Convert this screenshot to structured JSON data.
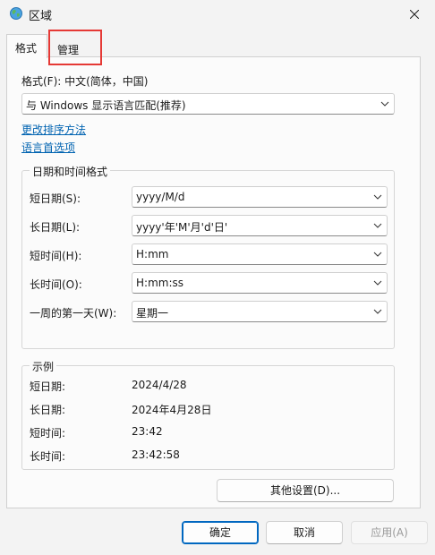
{
  "window": {
    "title": "区域"
  },
  "tabs": [
    {
      "label": "格式"
    },
    {
      "label": "管理"
    }
  ],
  "format": {
    "label": "格式(F): 中文(简体，中国)",
    "dropdown_value": "与 Windows 显示语言匹配(推荐)"
  },
  "links": {
    "sort": "更改排序方法",
    "language_prefs": "语言首选项"
  },
  "datetime": {
    "title": "日期和时间格式",
    "rows": [
      {
        "label": "短日期(S):",
        "value": "yyyy/M/d"
      },
      {
        "label": "长日期(L):",
        "value": "yyyy'年'M'月'd'日'"
      },
      {
        "label": "短时间(H):",
        "value": "H:mm"
      },
      {
        "label": "长时间(O):",
        "value": "H:mm:ss"
      },
      {
        "label": "一周的第一天(W):",
        "value": "星期一"
      }
    ]
  },
  "examples": {
    "title": "示例",
    "rows": [
      {
        "label": "短日期:",
        "value": "2024/4/28"
      },
      {
        "label": "长日期:",
        "value": "2024年4月28日"
      },
      {
        "label": "短时间:",
        "value": "23:42"
      },
      {
        "label": "长时间:",
        "value": "23:42:58"
      }
    ]
  },
  "buttons": {
    "other_settings": "其他设置(D)...",
    "ok": "确定",
    "cancel": "取消",
    "apply": "应用(A)"
  },
  "colors": {
    "link": "#0063b1",
    "highlight_box": "#e53935",
    "primary_border": "#0067c0"
  }
}
